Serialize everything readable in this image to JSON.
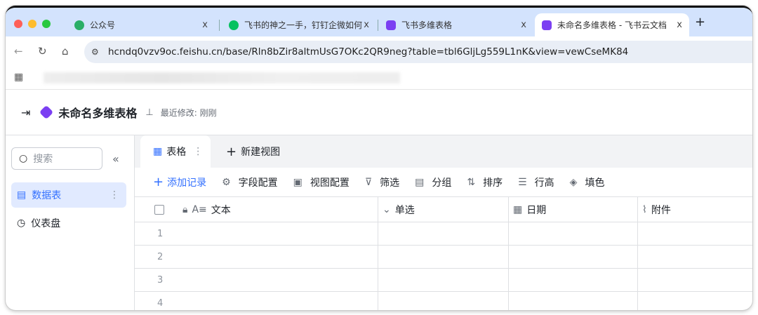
{
  "browser": {
    "tabs": [
      {
        "title": "公众号",
        "icon_color": "#2aae67",
        "icon": "wechat-channel-icon"
      },
      {
        "title": "飞书的神之一手，钉钉企微如何",
        "icon_color": "#07c160",
        "icon": "wechat-icon"
      },
      {
        "title": "飞书多维表格",
        "icon_color": "#7b3ff2",
        "icon": "base-icon"
      },
      {
        "title": "未命名多维表格 - 飞书云文档",
        "icon_color": "#7b3ff2",
        "icon": "base-icon",
        "active": true
      }
    ],
    "close": "x",
    "new_tab": "+",
    "url": "hcndq0vzv9oc.feishu.cn/base/Rln8bZir8altmUsG7OKc2QR9neg?table=tbl6GljLg559L1nK&view=vewCseMK84"
  },
  "app": {
    "title": "未命名多维表格",
    "last_modified": "最近修改: 刚刚"
  },
  "sidebar": {
    "search_placeholder": "搜索",
    "collapse": "«",
    "items": [
      {
        "label": "数据表",
        "active": true
      },
      {
        "label": "仪表盘"
      }
    ]
  },
  "views": {
    "active": "表格",
    "new_view": "新建视图"
  },
  "toolbar": {
    "add_record": "添加记录",
    "field_config": "字段配置",
    "view_config": "视图配置",
    "filter": "筛选",
    "group": "分组",
    "sort": "排序",
    "row_height": "行高",
    "fill": "填色"
  },
  "table": {
    "columns": [
      "文本",
      "单选",
      "日期",
      "附件"
    ],
    "rows": [
      "1",
      "2",
      "3",
      "4"
    ]
  },
  "colors": {
    "accent": "#3370ff",
    "active_bg": "#e1eaff"
  }
}
